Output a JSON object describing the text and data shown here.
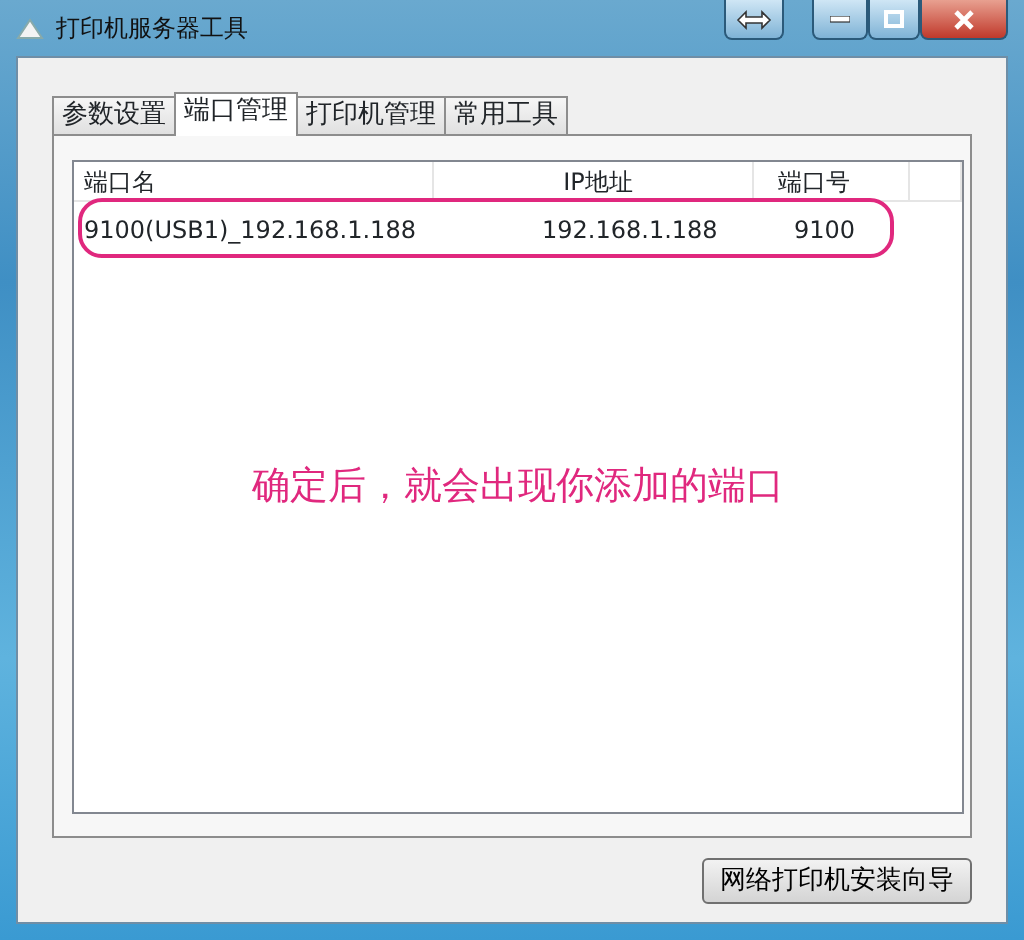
{
  "window": {
    "title": "打印机服务器工具"
  },
  "tabs": [
    {
      "label": "参数设置",
      "selected": false
    },
    {
      "label": "端口管理",
      "selected": true
    },
    {
      "label": "打印机管理",
      "selected": false
    },
    {
      "label": "常用工具",
      "selected": false
    }
  ],
  "table": {
    "columns": [
      "端口名",
      "IP地址",
      "端口号"
    ],
    "rows": [
      [
        "9100(USB1)_192.168.1.188",
        "192.168.1.188",
        "9100"
      ]
    ]
  },
  "annotation": "确定后，就会出现你添加的端口",
  "buttons": [
    "网络打印机安装向导"
  ]
}
